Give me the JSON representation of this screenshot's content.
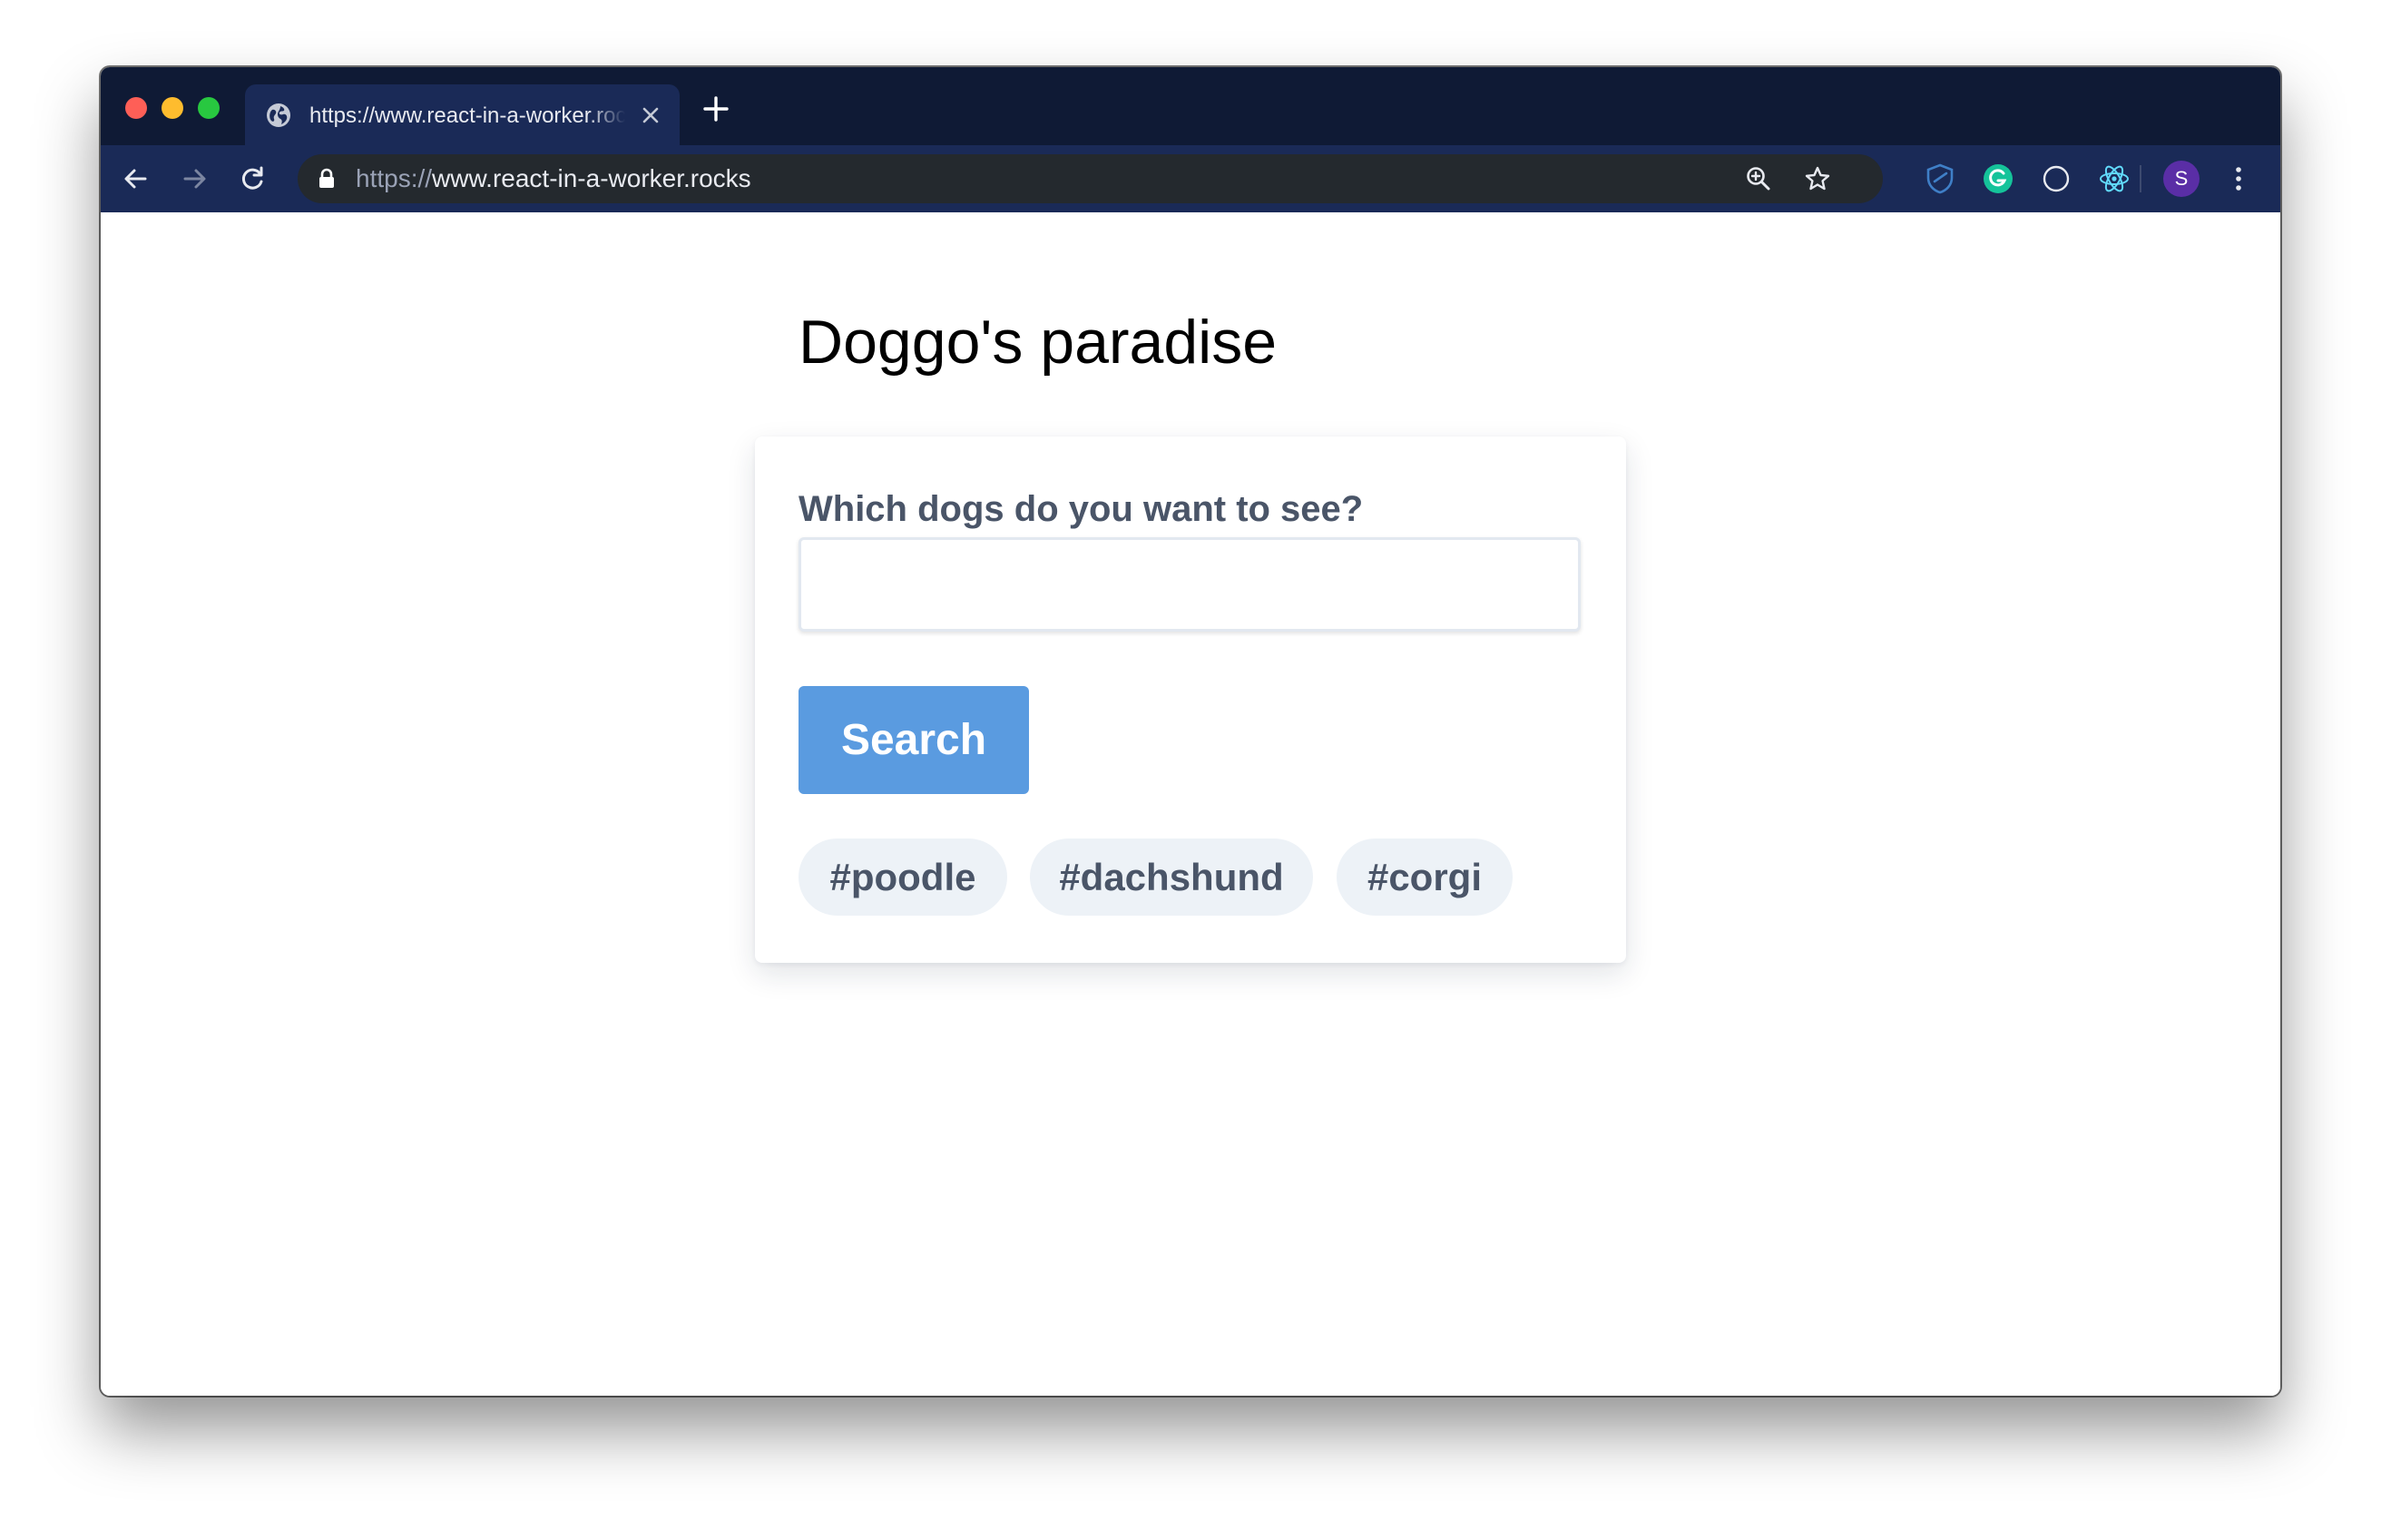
{
  "browser": {
    "tab": {
      "title": "https://www.react-in-a-worker.rocks",
      "favicon": "globe-icon",
      "close_icon": "close-icon"
    },
    "new_tab_icon": "plus-icon",
    "toolbar": {
      "back_icon": "arrow-left-icon",
      "forward_icon": "arrow-right-icon",
      "reload_icon": "reload-icon",
      "lock_icon": "lock-icon",
      "url_scheme": "https://",
      "url_host": "www.react-in-a-worker.rocks",
      "zoom_icon": "zoom-in-icon",
      "bookmark_icon": "star-icon",
      "extensions": [
        "shield-extension-icon",
        "grammarly-icon",
        "circle-extension-icon",
        "react-devtools-icon"
      ],
      "profile_initial": "S",
      "menu_icon": "more-vertical-icon"
    },
    "colors": {
      "tabbar": "#0f1a35",
      "toolbar": "#1a2a57",
      "omnibox": "#24292e",
      "accent_button": "#5a9be0",
      "tag_bg": "#edf2f7",
      "label_text": "#4a5568",
      "avatar": "#5a2ea6"
    }
  },
  "page": {
    "title": "Doggo's paradise",
    "search": {
      "label": "Which dogs do you want to see?",
      "value": "",
      "placeholder": ""
    },
    "search_button": "Search",
    "tags": [
      "#poodle",
      "#dachshund",
      "#corgi"
    ]
  }
}
